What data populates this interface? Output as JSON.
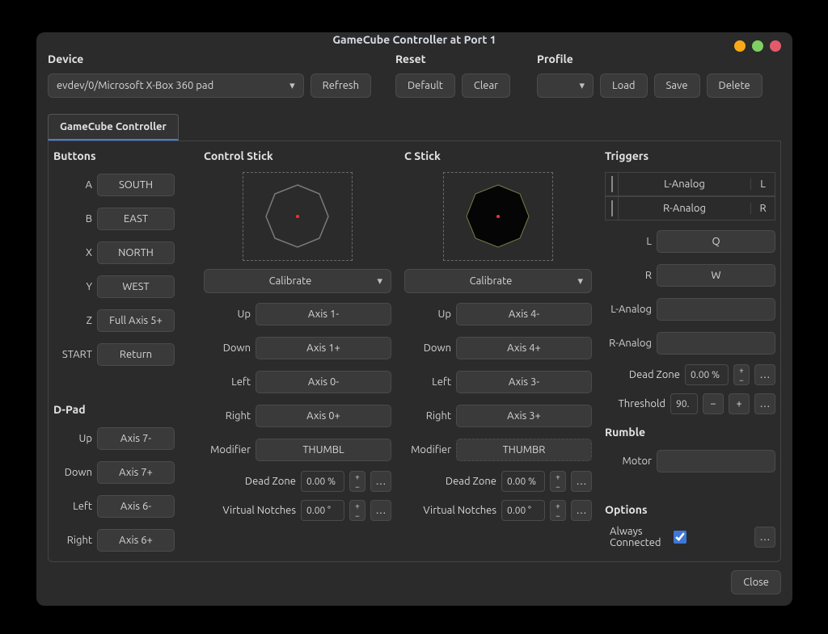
{
  "window_title": "GameCube Controller at Port 1",
  "sections": {
    "device": "Device",
    "reset": "Reset",
    "profile": "Profile"
  },
  "device": {
    "selected": "evdev/0/Microsoft X-Box 360 pad"
  },
  "buttons": {
    "refresh": "Refresh",
    "default": "Default",
    "clear": "Clear",
    "load": "Load",
    "save": "Save",
    "delete": "Delete",
    "close": "Close"
  },
  "tab": {
    "label": "GameCube Controller"
  },
  "groups": {
    "buttons": "Buttons",
    "dpad": "D-Pad",
    "ctrlstick": "Control Stick",
    "cstick": "C Stick",
    "triggers": "Triggers",
    "rumble": "Rumble",
    "options": "Options"
  },
  "btnmap": {
    "A": {
      "lbl": "A",
      "val": "SOUTH"
    },
    "B": {
      "lbl": "B",
      "val": "EAST"
    },
    "X": {
      "lbl": "X",
      "val": "NORTH"
    },
    "Y": {
      "lbl": "Y",
      "val": "WEST"
    },
    "Z": {
      "lbl": "Z",
      "val": "Full Axis 5+"
    },
    "START": {
      "lbl": "START",
      "val": "Return"
    }
  },
  "dpad": {
    "Up": {
      "lbl": "Up",
      "val": "Axis 7-"
    },
    "Down": {
      "lbl": "Down",
      "val": "Axis 7+"
    },
    "Left": {
      "lbl": "Left",
      "val": "Axis 6-"
    },
    "Right": {
      "lbl": "Right",
      "val": "Axis 6+"
    }
  },
  "ctrlstick": {
    "calibrate": "Calibrate",
    "Up": {
      "lbl": "Up",
      "val": "Axis 1-"
    },
    "Down": {
      "lbl": "Down",
      "val": "Axis 1+"
    },
    "Left": {
      "lbl": "Left",
      "val": "Axis 0-"
    },
    "Right": {
      "lbl": "Right",
      "val": "Axis 0+"
    },
    "Modifier": {
      "lbl": "Modifier",
      "val": "THUMBL"
    },
    "deadzone_lbl": "Dead Zone",
    "deadzone_val": "0.00 %",
    "notches_lbl": "Virtual Notches",
    "notches_val": "0.00 °"
  },
  "cstick": {
    "calibrate": "Calibrate",
    "Up": {
      "lbl": "Up",
      "val": "Axis 4-"
    },
    "Down": {
      "lbl": "Down",
      "val": "Axis 4+"
    },
    "Left": {
      "lbl": "Left",
      "val": "Axis 3-"
    },
    "Right": {
      "lbl": "Right",
      "val": "Axis 3+"
    },
    "Modifier": {
      "lbl": "Modifier",
      "val": "THUMBR"
    },
    "deadzone_lbl": "Dead Zone",
    "deadzone_val": "0.00 %",
    "notches_lbl": "Virtual Notches",
    "notches_val": "0.00 °"
  },
  "triggers": {
    "l_analog_lbl": "L-Analog",
    "l_cap": "L",
    "r_analog_lbl": "R-Analog",
    "r_cap": "R",
    "L": {
      "lbl": "L",
      "val": "Q"
    },
    "R": {
      "lbl": "R",
      "val": "W"
    },
    "LAnalog": {
      "lbl": "L-Analog",
      "val": ""
    },
    "RAnalog": {
      "lbl": "R-Analog",
      "val": ""
    },
    "deadzone_lbl": "Dead Zone",
    "deadzone_val": "0.00 %",
    "threshold_lbl": "Threshold",
    "threshold_val": "90."
  },
  "rumble": {
    "motor_lbl": "Motor",
    "motor_val": ""
  },
  "options": {
    "always_connected_lbl": "Always Connected",
    "always_connected": true
  }
}
